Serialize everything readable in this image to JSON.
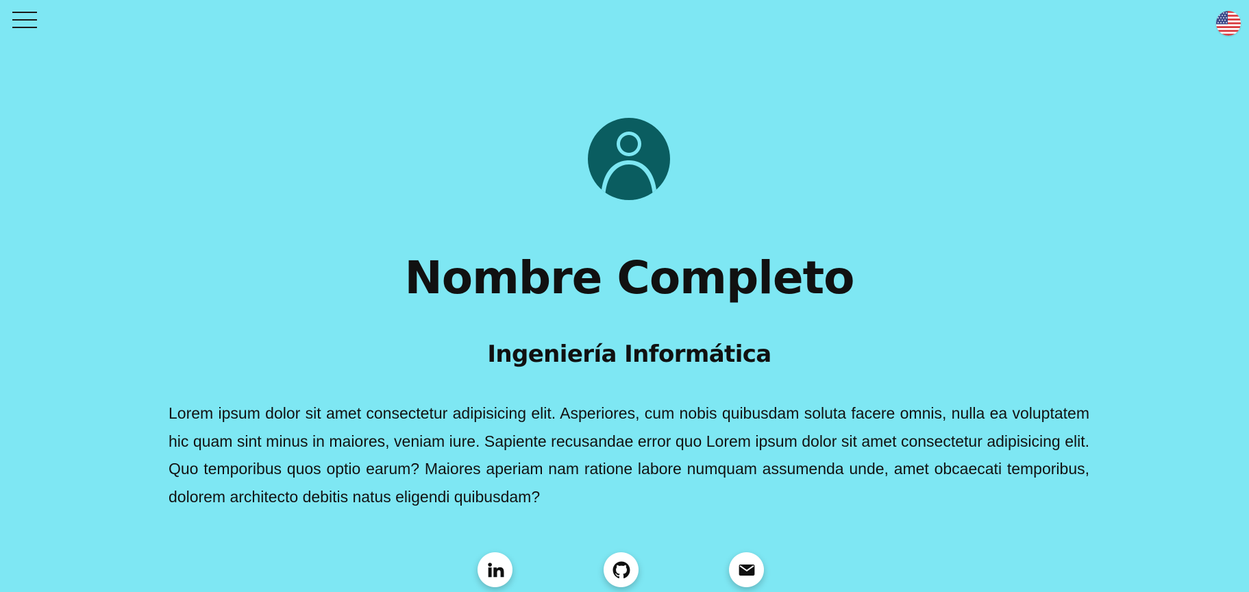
{
  "header": {
    "menu_icon": "hamburger-menu-icon",
    "language_icon": "us-flag-icon"
  },
  "profile": {
    "avatar_icon": "user-avatar-icon",
    "name": "Nombre Completo",
    "title": "Ingeniería Informática",
    "bio": "Lorem ipsum dolor sit amet consectetur adipisicing elit. Asperiores, cum nobis quibusdam soluta facere omnis, nulla ea voluptatem hic quam sint minus in maiores, veniam iure. Sapiente recusandae error quo Lorem ipsum dolor sit amet consectetur adipisicing elit. Quo temporibus quos optio earum? Maiores aperiam nam ratione labore numquam assumenda unde, amet obcaecati temporibus, dolorem architecto debitis natus eligendi quibusdam?"
  },
  "socials": [
    {
      "icon": "linkedin-icon"
    },
    {
      "icon": "github-icon"
    },
    {
      "icon": "mail-icon"
    }
  ],
  "colors": {
    "background": "#7ee7f3",
    "accent": "#0a5d60",
    "text": "#121212"
  }
}
